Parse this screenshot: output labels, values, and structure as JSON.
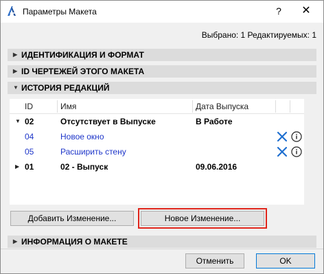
{
  "window": {
    "title": "Параметры Макета",
    "help": "?",
    "close": "✕"
  },
  "selection_info": "Выбрано: 1 Редактируемых: 1",
  "sections": {
    "identification": "ИДЕНТИФИКАЦИЯ И ФОРМАТ",
    "drawing_ids": "ID ЧЕРТЕЖЕЙ ЭТОГО МАКЕТА",
    "revision_history": "ИСТОРИЯ РЕДАКЦИЙ",
    "layout_info": "ИНФОРМАЦИЯ О МАКЕТЕ"
  },
  "table": {
    "columns": [
      "ID",
      "Имя",
      "Дата Выпуска"
    ],
    "rows": [
      {
        "id": "02",
        "name": "Отсутствует в Выпуске",
        "date": "В Работе"
      },
      {
        "id": "04",
        "name": "Новое окно",
        "date": ""
      },
      {
        "id": "05",
        "name": "Расширить стену",
        "date": ""
      },
      {
        "id": "01",
        "name": "02 - Выпуск",
        "date": "09.06.2016"
      }
    ]
  },
  "buttons": {
    "add_change": "Добавить Изменение...",
    "new_change": "Новое Изменение...",
    "cancel": "Отменить",
    "ok": "OK"
  },
  "colors": {
    "accent_blue": "#1d35c9",
    "x_icon_blue": "#1f6fd0",
    "highlight_red": "#e0251b"
  }
}
